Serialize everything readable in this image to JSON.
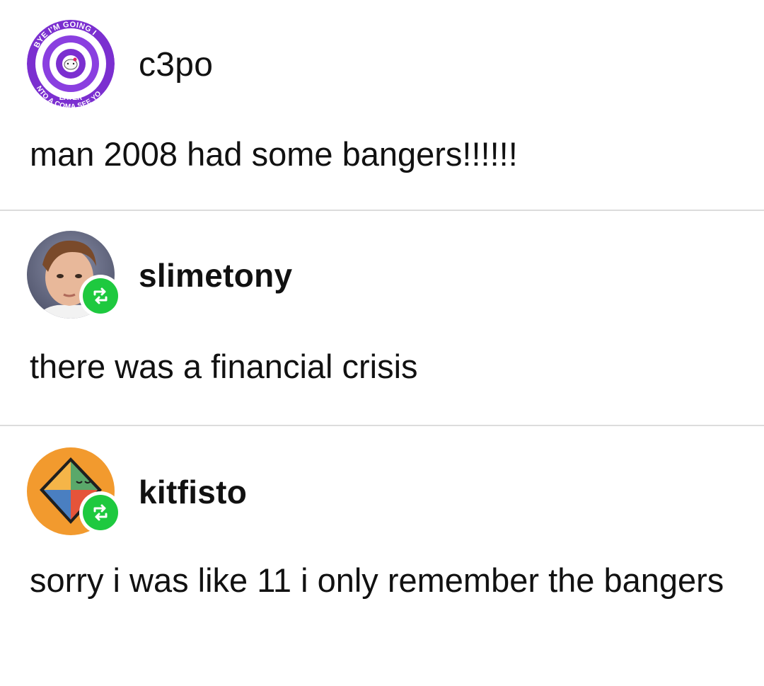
{
  "posts": [
    {
      "username": "c3po",
      "body": "man 2008 had some bangers!!!!!!",
      "avatar": {
        "icon": "hypnotic-spiral-hello-kitty-avatar",
        "top_text": "BYE I'M GOING I",
        "bottom_text": "NTO A COMA SEE YO",
        "bottom_text_2": "LATER",
        "colors": [
          "#7b2fd0",
          "#ffffff"
        ]
      },
      "reblog": false
    },
    {
      "username": "slimetony",
      "body": "there was a financial crisis",
      "avatar": {
        "icon": "child-portrait-avatar"
      },
      "reblog": true
    },
    {
      "username": "kitfisto",
      "body": "sorry i was like 11 i only remember the bangers",
      "avatar": {
        "icon": "geometric-face-avatar",
        "colors": [
          "#f29a2e",
          "#5aa86a",
          "#e5543a",
          "#4a7fc1"
        ]
      },
      "reblog": true
    }
  ],
  "colors": {
    "reblog_badge": "#1ec93f",
    "divider": "#dcdcdc",
    "text": "#111111"
  }
}
